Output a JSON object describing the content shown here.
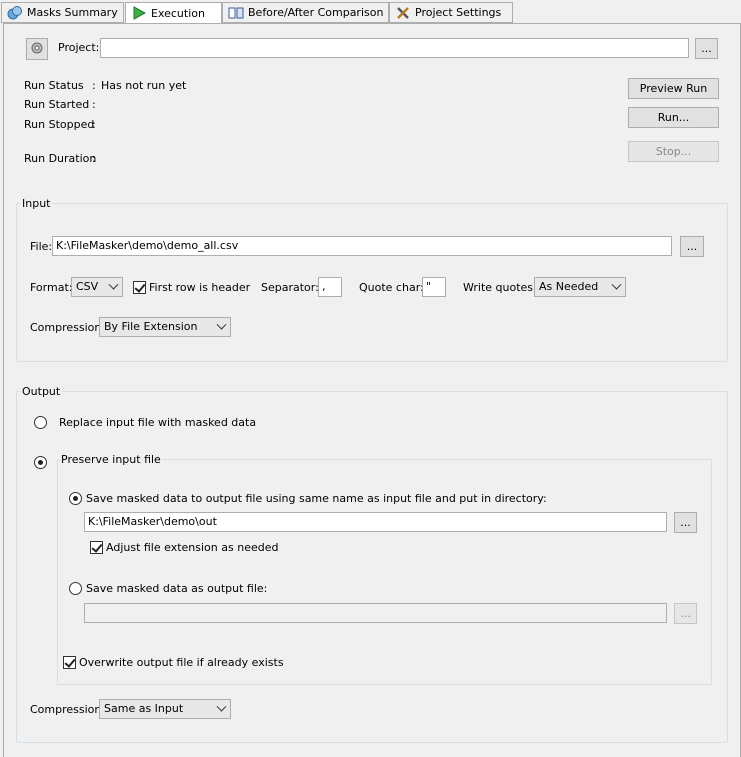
{
  "tabs": [
    {
      "label": "Masks Summary",
      "icon": "masks-icon"
    },
    {
      "label": "Execution",
      "icon": "play-icon"
    },
    {
      "label": "Before/After Comparison",
      "icon": "compare-icon"
    },
    {
      "label": "Project Settings",
      "icon": "tools-icon"
    }
  ],
  "project": {
    "label": "Project:",
    "value": "",
    "browse": "..."
  },
  "run": {
    "status_label": "Run Status",
    "status_sep": ":",
    "status_value": "Has not run yet",
    "started_label": "Run Started",
    "started_sep": ":",
    "stopped_label": "Run Stopped",
    "stopped_sep": ":",
    "duration_label": "Run Duration",
    "duration_sep": ":",
    "preview_button": "Preview Run",
    "run_button": "Run...",
    "stop_button": "Stop..."
  },
  "input": {
    "title": "Input",
    "file_label": "File:",
    "file_value": "K:\\FileMasker\\demo\\demo_all.csv",
    "browse": "...",
    "format_label": "Format:",
    "format_value": "CSV",
    "header_label": "First row is header",
    "separator_label": "Separator:",
    "separator_value": ",",
    "quote_label": "Quote char:",
    "quote_value": "\"",
    "write_quotes_label": "Write quotes:",
    "write_quotes_value": "As Needed",
    "compression_label": "Compression:",
    "compression_value": "By File Extension"
  },
  "output": {
    "title": "Output",
    "replace_label": "Replace input file with masked data",
    "preserve_label": "Preserve input file",
    "same_name_label": "Save masked data to output file using same name as input file and put in directory:",
    "dir_value": "K:\\FileMasker\\demo\\out",
    "browse": "...",
    "adjust_ext_label": "Adjust file extension as needed",
    "save_as_label": "Save masked data as output file:",
    "save_as_value": "",
    "overwrite_label": "Overwrite output file if already exists",
    "compression_label": "Compression:",
    "compression_value": "Same as Input"
  }
}
